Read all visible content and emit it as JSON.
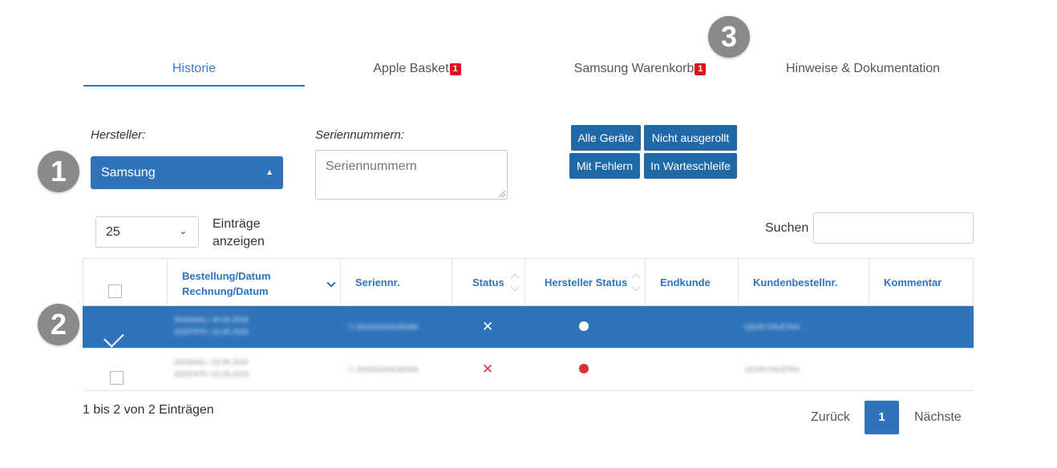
{
  "tabs": [
    {
      "label": "Historie",
      "active": true
    },
    {
      "label": "Apple Basket",
      "badge": "1"
    },
    {
      "label": "Samsung Warenkorb",
      "badge": "1"
    },
    {
      "label": "Hinweise & Dokumentation"
    }
  ],
  "markers": [
    "1",
    "2",
    "3"
  ],
  "filters": {
    "manufacturer_label": "Hersteller:",
    "manufacturer_value": "Samsung",
    "serials_label": "Seriennummern:",
    "serials_placeholder": "Seriennummern",
    "buttons": [
      "Alle Geräte",
      "Nicht ausgerollt",
      "Mit Fehlern",
      "In Warteschleife"
    ]
  },
  "length": {
    "value": "25",
    "label": "Einträge anzeigen"
  },
  "search": {
    "label": "Suchen",
    "value": ""
  },
  "table": {
    "columns": [
      {
        "label": ""
      },
      {
        "label": "Bestellung/Datum\nRechnung/Datum",
        "line1": "Bestellung/Datum",
        "line2": "Rechnung/Datum"
      },
      {
        "label": "Seriennr."
      },
      {
        "label": "Status"
      },
      {
        "label": "Hersteller Status"
      },
      {
        "label": "Endkunde"
      },
      {
        "label": "Kundenbestellnr."
      },
      {
        "label": "Kommentar"
      }
    ],
    "rows": [
      {
        "selected": true,
        "order_line1": "20234441 / 20.05.2019",
        "order_line2": "20237979 / 22.05.2019",
        "serial": "☐ 20191010414D340",
        "status": "✕",
        "status_color": "#ffffff",
        "manufacturer_status_color": "#ffffff",
        "customer_order": "LEON CALETKA"
      },
      {
        "selected": false,
        "order_line1": "20234441 / 23.05.2019",
        "order_line2": "20237979 / 22.05.2019",
        "serial": "☐ 20191010414D346",
        "status": "✕",
        "status_color": "#d9323a",
        "manufacturer_status_color": "#d9323a",
        "customer_order": "LEON CALETKA"
      }
    ]
  },
  "footer": {
    "info": "1 bis 2 von 2 Einträgen",
    "prev": "Zurück",
    "page": "1",
    "next": "Nächste"
  },
  "colors": {
    "accent": "#2f74bb",
    "button": "#1f6aa6",
    "badge": "#e0101b",
    "marker": "#8a8a8a"
  }
}
